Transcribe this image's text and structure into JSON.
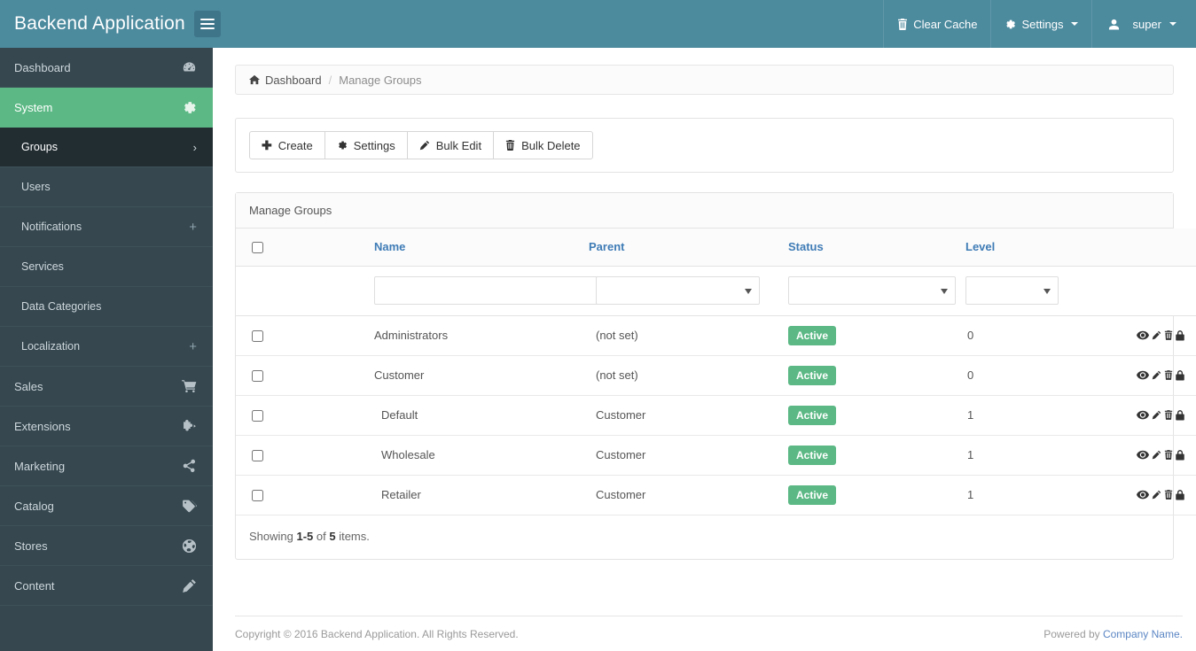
{
  "header": {
    "brand_title": "Backend Application",
    "menu_toggle_icon": "hamburger-icon",
    "nav": [
      {
        "label": "Clear Cache",
        "icon": "trash-icon",
        "caret": false
      },
      {
        "label": "Settings",
        "icon": "gear-icon",
        "caret": true
      },
      {
        "label": "super",
        "icon": "user-icon",
        "caret": true
      }
    ]
  },
  "sidebar": {
    "items": [
      {
        "label": "Dashboard",
        "icon": "dashboard-icon",
        "state": "normal"
      },
      {
        "label": "System",
        "icon": "gear-icon",
        "state": "active"
      },
      {
        "label": "Groups",
        "icon": "chevron-right-icon",
        "state": "sub-current"
      },
      {
        "label": "Users",
        "icon": "",
        "state": "sub"
      },
      {
        "label": "Notifications",
        "icon": "plus-icon",
        "state": "sub"
      },
      {
        "label": "Services",
        "icon": "",
        "state": "sub"
      },
      {
        "label": "Data Categories",
        "icon": "",
        "state": "sub"
      },
      {
        "label": "Localization",
        "icon": "plus-icon",
        "state": "sub"
      },
      {
        "label": "Sales",
        "icon": "cart-icon",
        "state": "normal"
      },
      {
        "label": "Extensions",
        "icon": "puzzle-icon",
        "state": "normal"
      },
      {
        "label": "Marketing",
        "icon": "share-icon",
        "state": "normal"
      },
      {
        "label": "Catalog",
        "icon": "tags-icon",
        "state": "normal"
      },
      {
        "label": "Stores",
        "icon": "globe-icon",
        "state": "normal"
      },
      {
        "label": "Content",
        "icon": "pencil-icon",
        "state": "normal"
      }
    ]
  },
  "breadcrumb": {
    "home_icon": "home-icon",
    "root": "Dashboard",
    "separator": "/",
    "current": "Manage Groups"
  },
  "toolbar": {
    "buttons": [
      {
        "label": "Create",
        "icon": "plus-icon"
      },
      {
        "label": "Settings",
        "icon": "gear-icon"
      },
      {
        "label": "Bulk Edit",
        "icon": "pencil-icon"
      },
      {
        "label": "Bulk Delete",
        "icon": "trash-icon"
      }
    ]
  },
  "panel": {
    "title": "Manage Groups"
  },
  "table": {
    "columns": [
      "Name",
      "Parent",
      "Status",
      "Level"
    ],
    "filters": {
      "name_value": "",
      "name_placeholder": "",
      "parent_value": "",
      "status_value": "",
      "level_value": ""
    },
    "rows": [
      {
        "name": "Administrators",
        "parent": "(not set)",
        "status": "Active",
        "level": "0",
        "indent": false,
        "checked": false
      },
      {
        "name": "Customer",
        "parent": "(not set)",
        "status": "Active",
        "level": "0",
        "indent": false,
        "checked": false
      },
      {
        "name": "Default",
        "parent": "Customer",
        "status": "Active",
        "level": "1",
        "indent": true,
        "checked": false
      },
      {
        "name": "Wholesale",
        "parent": "Customer",
        "status": "Active",
        "level": "1",
        "indent": true,
        "checked": false
      },
      {
        "name": "Retailer",
        "parent": "Customer",
        "status": "Active",
        "level": "1",
        "indent": true,
        "checked": false
      }
    ],
    "row_actions": [
      "view-icon",
      "edit-icon",
      "delete-icon",
      "permissions-icon"
    ],
    "showing_prefix": "Showing ",
    "showing_range": "1-5",
    "showing_middle": " of ",
    "showing_total": "5",
    "showing_suffix": " items."
  },
  "footer": {
    "copyright": "Copyright © 2016 Backend Application. All Rights Reserved.",
    "powered_prefix": "Powered by ",
    "powered_link": "Company Name."
  },
  "colors": {
    "header_blue": "#4c8a9e",
    "sidebar_dark": "#36474f",
    "accent_green": "#5cb985",
    "sub_current": "#222d32",
    "link_blue": "#4a7fb5"
  }
}
